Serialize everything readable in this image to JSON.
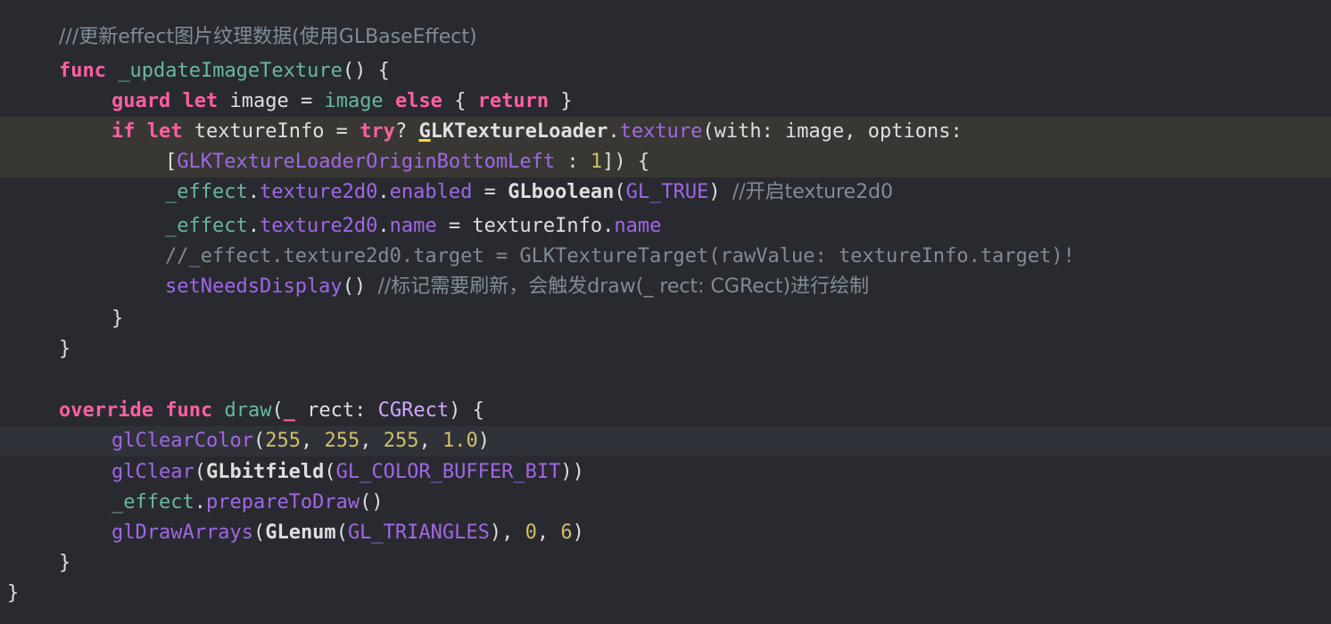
{
  "editor": {
    "lines": [
      [
        {
          "t": "///更新effect图片纹理数据(使用GLBaseEffect)",
          "c": "cm"
        }
      ],
      [
        {
          "t": "func",
          "c": "kw"
        },
        {
          "t": " ",
          "c": "pl"
        },
        {
          "t": "_updateImageTexture",
          "c": "fn"
        },
        {
          "t": "() {",
          "c": "pl"
        }
      ],
      [
        {
          "t": "guard",
          "c": "kw"
        },
        {
          "t": " ",
          "c": "pl"
        },
        {
          "t": "let",
          "c": "kw"
        },
        {
          "t": " image = ",
          "c": "pl"
        },
        {
          "t": "image",
          "c": "fn"
        },
        {
          "t": " ",
          "c": "pl"
        },
        {
          "t": "else",
          "c": "kw"
        },
        {
          "t": " { ",
          "c": "pl"
        },
        {
          "t": "return",
          "c": "kw"
        },
        {
          "t": " }",
          "c": "pl"
        }
      ],
      [
        {
          "t": "if",
          "c": "kw"
        },
        {
          "t": " ",
          "c": "pl"
        },
        {
          "t": "let",
          "c": "kw"
        },
        {
          "t": " textureInfo = ",
          "c": "pl"
        },
        {
          "t": "try",
          "c": "kw"
        },
        {
          "t": "? ",
          "c": "pl"
        },
        {
          "t": "G",
          "c": "pla warn-u"
        },
        {
          "t": "LKTextureLoader",
          "c": "pla"
        },
        {
          "t": ".",
          "c": "pl"
        },
        {
          "t": "texture",
          "c": "mc"
        },
        {
          "t": "(with: image, options:",
          "c": "pl"
        }
      ],
      [
        {
          "t": "[",
          "c": "pl"
        },
        {
          "t": "GLKTextureLoaderOriginBottomLeft",
          "c": "mc"
        },
        {
          "t": " : ",
          "c": "pl"
        },
        {
          "t": "1",
          "c": "nm"
        },
        {
          "t": "]) {",
          "c": "pl"
        }
      ],
      [
        {
          "t": "_effect",
          "c": "fn"
        },
        {
          "t": ".",
          "c": "pl"
        },
        {
          "t": "texture2d0",
          "c": "mc"
        },
        {
          "t": ".",
          "c": "pl"
        },
        {
          "t": "enabled",
          "c": "mc"
        },
        {
          "t": " = ",
          "c": "pl"
        },
        {
          "t": "GLboolean",
          "c": "pla"
        },
        {
          "t": "(",
          "c": "pl"
        },
        {
          "t": "GL_TRUE",
          "c": "mc"
        },
        {
          "t": ") ",
          "c": "pl"
        },
        {
          "t": "//开启texture2d0",
          "c": "cm"
        }
      ],
      [
        {
          "t": "_effect",
          "c": "fn"
        },
        {
          "t": ".",
          "c": "pl"
        },
        {
          "t": "texture2d0",
          "c": "mc"
        },
        {
          "t": ".",
          "c": "pl"
        },
        {
          "t": "name",
          "c": "mc"
        },
        {
          "t": " = textureInfo.",
          "c": "pl"
        },
        {
          "t": "name",
          "c": "mc"
        }
      ],
      [
        {
          "t": "//_effect.texture2d0.target = GLKTextureTarget(rawValue: textureInfo.target)!",
          "c": "cm"
        }
      ],
      [
        {
          "t": "setNeedsDisplay",
          "c": "mc"
        },
        {
          "t": "() ",
          "c": "pl"
        },
        {
          "t": "//标记需要刷新，会触发draw(_ rect: CGRect)进行绘制",
          "c": "cm"
        }
      ],
      [
        {
          "t": "}",
          "c": "pl"
        }
      ],
      [
        {
          "t": "}",
          "c": "pl"
        }
      ],
      [],
      [
        {
          "t": "override",
          "c": "kw"
        },
        {
          "t": " ",
          "c": "pl"
        },
        {
          "t": "func",
          "c": "kw"
        },
        {
          "t": " ",
          "c": "pl"
        },
        {
          "t": "draw",
          "c": "fn"
        },
        {
          "t": "(",
          "c": "pl"
        },
        {
          "t": "_",
          "c": "kw"
        },
        {
          "t": " rect: ",
          "c": "pl"
        },
        {
          "t": "CGRect",
          "c": "tp"
        },
        {
          "t": ") {",
          "c": "pl"
        }
      ],
      [
        {
          "t": "glClearColor",
          "c": "mc"
        },
        {
          "t": "(",
          "c": "pl"
        },
        {
          "t": "255",
          "c": "nm"
        },
        {
          "t": ", ",
          "c": "pl"
        },
        {
          "t": "255",
          "c": "nm"
        },
        {
          "t": ", ",
          "c": "pl"
        },
        {
          "t": "255",
          "c": "nm"
        },
        {
          "t": ", ",
          "c": "pl"
        },
        {
          "t": "1.0",
          "c": "nm"
        },
        {
          "t": ")",
          "c": "pl"
        }
      ],
      [
        {
          "t": "glClear",
          "c": "mc"
        },
        {
          "t": "(",
          "c": "pl"
        },
        {
          "t": "GLbitfield",
          "c": "pla"
        },
        {
          "t": "(",
          "c": "pl"
        },
        {
          "t": "GL_COLOR_BUFFER_BIT",
          "c": "mc"
        },
        {
          "t": "))",
          "c": "pl"
        }
      ],
      [
        {
          "t": "_effect",
          "c": "fn"
        },
        {
          "t": ".",
          "c": "pl"
        },
        {
          "t": "prepareToDraw",
          "c": "mc"
        },
        {
          "t": "()",
          "c": "pl"
        }
      ],
      [
        {
          "t": "glDrawArrays",
          "c": "mc"
        },
        {
          "t": "(",
          "c": "pl"
        },
        {
          "t": "GLenum",
          "c": "pla"
        },
        {
          "t": "(",
          "c": "pl"
        },
        {
          "t": "GL_TRIANGLES",
          "c": "mc"
        },
        {
          "t": "), ",
          "c": "pl"
        },
        {
          "t": "0",
          "c": "nm"
        },
        {
          "t": ", ",
          "c": "pl"
        },
        {
          "t": "6",
          "c": "nm"
        },
        {
          "t": ")",
          "c": "pl"
        }
      ],
      [
        {
          "t": "}",
          "c": "pl"
        }
      ],
      [
        {
          "t": "}",
          "c": "pl"
        }
      ]
    ]
  }
}
